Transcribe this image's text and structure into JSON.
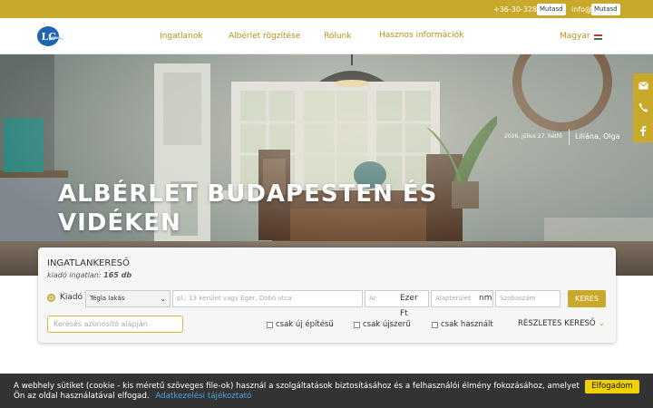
{
  "topbar": {
    "phone": "+36-30-328",
    "phone_button": "Mutasd",
    "email": "info@",
    "email_button": "Mutasd"
  },
  "nav": {
    "logo_text": "LC",
    "items": [
      "Ingatlanok",
      "Albérlet rögzítése",
      "Rólunk",
      "Hasznos információk"
    ],
    "language": "Magyar"
  },
  "hero": {
    "title": "ALBÉRLET BUDAPESTEN ÉS VIDÉKEN",
    "date": "2026. július 27. hétfő",
    "names": "Liliána, Olga"
  },
  "side_icons": [
    "mail-icon",
    "phone-icon",
    "facebook-icon"
  ],
  "search": {
    "title": "INGATLANKERESŐ",
    "subtitle_prefix": "kiadó ingatlan:",
    "subtitle_count": "165 db",
    "mode_label": "Kiadó",
    "type_select": "Tégla lakás",
    "location_placeholder": "pl.: 13 kerület vagy Eger, Dobó utca",
    "price_placeholder": "Ár",
    "price_unit": "Ezer Ft",
    "area_placeholder": "Alapterület",
    "area_unit": "nm",
    "rooms_placeholder": "Szobaszám",
    "search_button": "KERES",
    "id_placeholder": "Keresés azonosító alapján",
    "checkboxes": [
      "csak új építésű",
      "csak újszerű",
      "csak használt"
    ],
    "detailed": "RÉSZLETES KERESŐ"
  },
  "cookie": {
    "line1": "A webhely sütiket (cookie - kis méretű szöveges file-ok) használ a szolgáltatások biztosításához és a felhasználói élmény fokozásához, amelyet",
    "line2": "Ön az oldal használatával elfogad.",
    "link": "Adatkezelési tájékoztató",
    "accept": "Elfogadom"
  },
  "colors": {
    "accent": "#c8a92c",
    "cookie_bg": "#333333",
    "accept_bg": "#f1d000",
    "link": "#4ba3e0"
  }
}
